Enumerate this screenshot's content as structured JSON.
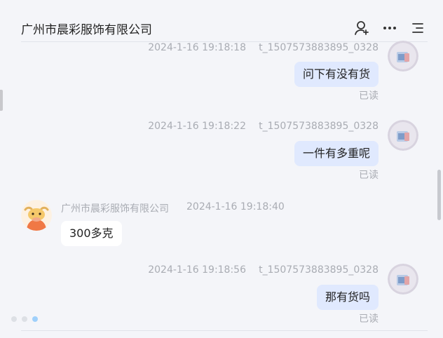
{
  "header": {
    "title": "广州市晨彩服饰有限公司",
    "icons": [
      "user-add-icon",
      "more-icon",
      "menu-icon"
    ]
  },
  "messages": [
    {
      "side": "me",
      "time": "2024-1-16 19:18:18",
      "sender": "t_1507573883895_0328",
      "text": "问下有没有货",
      "status": "已读"
    },
    {
      "side": "me",
      "time": "2024-1-16 19:18:22",
      "sender": "t_1507573883895_0328",
      "text": "一件有多重呢",
      "status": "已读"
    },
    {
      "side": "other",
      "time": "2024-1-16 19:18:40",
      "sender": "广州市晨彩服饰有限公司",
      "text": "300多克"
    },
    {
      "side": "me",
      "time": "2024-1-16 19:18:56",
      "sender": "t_1507573883895_0328",
      "text": "那有货吗",
      "status": "已读"
    }
  ],
  "colors": {
    "my_bubble": "#e0e9fe",
    "other_bubble": "#ffffff",
    "background": "#f4f5f9",
    "active_dot": "#9fd0fb"
  }
}
